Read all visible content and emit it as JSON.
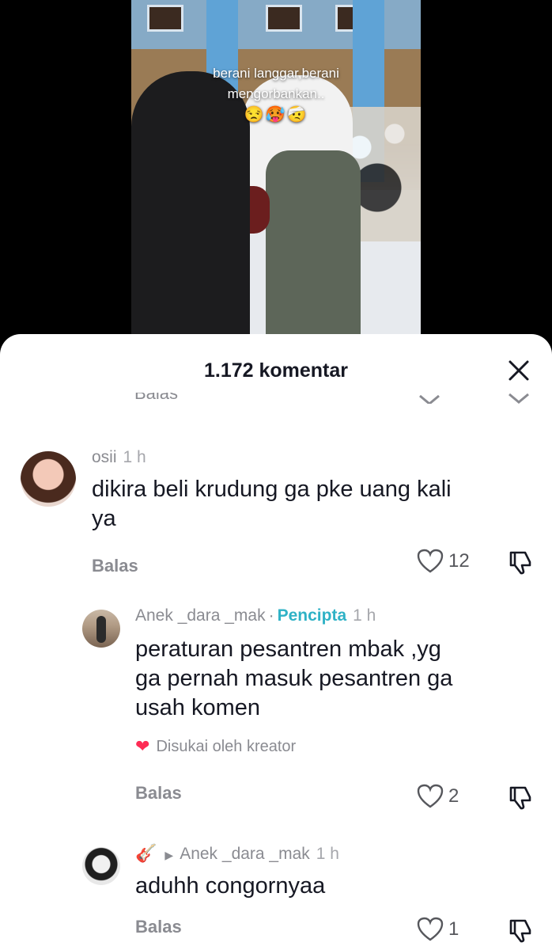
{
  "video": {
    "caption_line1": "berani langgar,berani",
    "caption_line2": "mengorbankan..",
    "caption_emoji": "😒🥵🤕"
  },
  "sheet": {
    "title": "1.172 komentar",
    "close_icon": "close-icon",
    "cutoff_reply_label": "Balas"
  },
  "comments": [
    {
      "username": "osii",
      "time": "1 h",
      "text_line1": "dikira beli krudung ga pke uang kali",
      "text_line2": "ya",
      "reply_label": "Balas",
      "likes": "12"
    },
    {
      "username": "Anek _dara _mak",
      "separator": "·",
      "creator_badge": "Pencipta",
      "time": "1 h",
      "text_line1": "peraturan pesantren mbak ,yg",
      "text_line2": "ga pernah masuk pesantren ga",
      "text_line3": "usah komen",
      "liked_by": "Disukai oleh kreator",
      "reply_label": "Balas",
      "likes": "2"
    },
    {
      "username_emoji": "🎸",
      "replying_to": "Anek _dara _mak",
      "time": "1 h",
      "text_line1": "aduhh congornyaa",
      "reply_label": "Balas",
      "likes": "1"
    }
  ],
  "colors": {
    "creator": "#2fb2c6",
    "liked_heart": "#fe2c55",
    "text": "#161823",
    "muted": "#8a8b91"
  }
}
